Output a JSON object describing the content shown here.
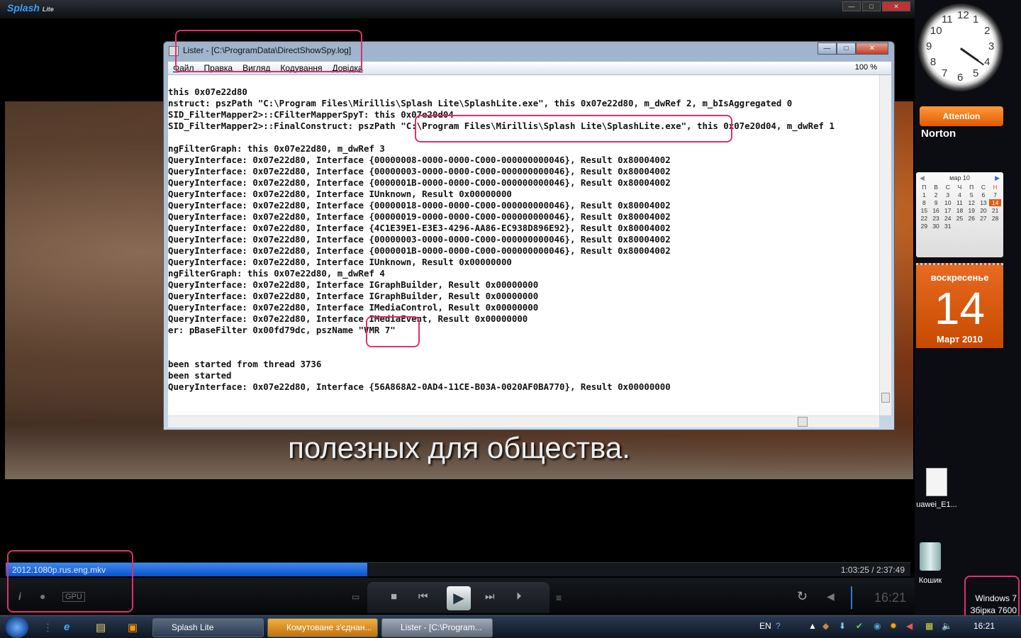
{
  "player": {
    "logo": "Splash",
    "logo_suffix": "Lite",
    "subtitle": "полезных для общества.",
    "filename": "2012.1080p.rus.eng.mkv",
    "timecode": "1:03:25 / 2:37:49",
    "progress_fraction": 0.4,
    "clock": "16:21",
    "gpu_label": "GPU",
    "info_icon": "i"
  },
  "lister": {
    "title": "Lister - [C:\\ProgramData\\DirectShowSpy.log]",
    "menu": [
      "Файл",
      "Правка",
      "Вигляд",
      "Кодування",
      "Довідка"
    ],
    "zoom": "100 %",
    "lines": [
      "this 0x07e22d80",
      "nstruct: pszPath \"C:\\Program Files\\Mirillis\\Splash Lite\\SplashLite.exe\", this 0x07e22d80, m_dwRef 2, m_bIsAggregated 0",
      "SID_FilterMapper2>::CFilterMapperSpyT: this 0x07e20d04",
      "SID_FilterMapper2>::FinalConstruct: pszPath \"C:\\Program Files\\Mirillis\\Splash Lite\\SplashLite.exe\", this 0x07e20d04, m_dwRef 1",
      "",
      "ngFilterGraph: this 0x07e22d80, m_dwRef 3",
      "QueryInterface: 0x07e22d80, Interface {00000008-0000-0000-C000-000000000046}, Result 0x80004002",
      "QueryInterface: 0x07e22d80, Interface {00000003-0000-0000-C000-000000000046}, Result 0x80004002",
      "QueryInterface: 0x07e22d80, Interface {0000001B-0000-0000-C000-000000000046}, Result 0x80004002",
      "QueryInterface: 0x07e22d80, Interface IUnknown, Result 0x00000000",
      "QueryInterface: 0x07e22d80, Interface {00000018-0000-0000-C000-000000000046}, Result 0x80004002",
      "QueryInterface: 0x07e22d80, Interface {00000019-0000-0000-C000-000000000046}, Result 0x80004002",
      "QueryInterface: 0x07e22d80, Interface {4C1E39E1-E3E3-4296-AA86-EC938D896E92}, Result 0x80004002",
      "QueryInterface: 0x07e22d80, Interface {00000003-0000-0000-C000-000000000046}, Result 0x80004002",
      "QueryInterface: 0x07e22d80, Interface {0000001B-0000-0000-C000-000000000046}, Result 0x80004002",
      "QueryInterface: 0x07e22d80, Interface IUnknown, Result 0x00000000",
      "ngFilterGraph: this 0x07e22d80, m_dwRef 4",
      "QueryInterface: 0x07e22d80, Interface IGraphBuilder, Result 0x00000000",
      "QueryInterface: 0x07e22d80, Interface IGraphBuilder, Result 0x00000000",
      "QueryInterface: 0x07e22d80, Interface IMediaControl, Result 0x00000000",
      "QueryInterface: 0x07e22d80, Interface IMediaEvent, Result 0x00000000",
      "er: pBaseFilter 0x00fd79dc, pszName \"VMR 7\"",
      "",
      "",
      "been started from thread 3736",
      "been started",
      "QueryInterface: 0x07e22d80, Interface {56A868A2-0AD4-11CE-B03A-0020AF0BA770}, Result 0x00000000"
    ]
  },
  "gadgets": {
    "clock_numbers": [
      "12",
      "1",
      "2",
      "3",
      "4",
      "5",
      "6",
      "7",
      "8",
      "9",
      "10",
      "11"
    ],
    "norton_attention": "Attention",
    "norton_logo": "Norton",
    "calendar": {
      "month_header": "мар 10",
      "weekdays": [
        "П",
        "В",
        "С",
        "Ч",
        "П",
        "С",
        "Н"
      ],
      "days": [
        "1",
        "2",
        "3",
        "4",
        "5",
        "6",
        "7",
        "8",
        "9",
        "10",
        "11",
        "12",
        "13",
        "14",
        "15",
        "16",
        "17",
        "18",
        "19",
        "20",
        "21",
        "22",
        "23",
        "24",
        "25",
        "26",
        "27",
        "28",
        "29",
        "30",
        "31"
      ],
      "today": "14",
      "weekday_name": "воскресенье",
      "month_year": "Март 2010"
    }
  },
  "desktop": {
    "icons": [
      {
        "label": "uawei_E1..."
      },
      {
        "label": "Кошик"
      }
    ],
    "watermark": [
      "Windows 7",
      "Збірка 7600"
    ]
  },
  "taskbar": {
    "buttons": [
      "Splash Lite",
      "Комутоване з'єднан...",
      "Lister - [C:\\Program..."
    ],
    "lang": "EN",
    "time": "16:21"
  },
  "colors": {
    "annotation": "#e0306a",
    "progress": "#1e6ae0",
    "calendar_accent": "#e05a10"
  }
}
